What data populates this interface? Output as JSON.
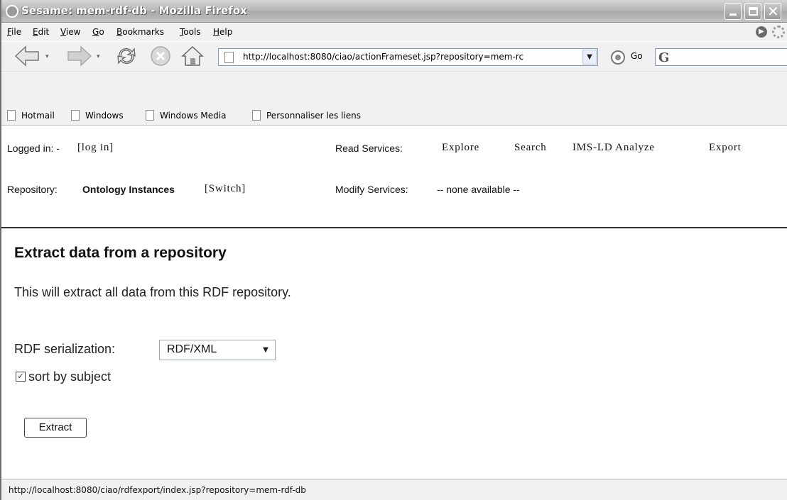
{
  "window": {
    "title": "Sesame: mem-rdf-db - Mozilla Firefox"
  },
  "menubar": {
    "items": [
      {
        "key": "F",
        "rest": "ile"
      },
      {
        "key": "E",
        "rest": "dit"
      },
      {
        "key": "V",
        "rest": "iew"
      },
      {
        "key": "G",
        "rest": "o"
      },
      {
        "key": "B",
        "rest": "ookmarks"
      },
      {
        "key": "T",
        "rest": "ools"
      },
      {
        "key": "H",
        "rest": "elp"
      }
    ]
  },
  "navbar": {
    "url": "http://localhost:8080/ciao/actionFrameset.jsp?repository=mem-rc",
    "go_label": "Go",
    "search_engine_glyph": "G",
    "icons": {
      "back": "back-arrow-icon",
      "forward": "forward-arrow-icon",
      "reload": "reload-icon",
      "stop": "stop-icon",
      "home": "home-icon"
    }
  },
  "bookmarks": [
    "Hotmail",
    "Windows",
    "Windows Media",
    "Personnaliser les liens"
  ],
  "header": {
    "logged_in": "Logged in: -",
    "log_in_link": "[log in]",
    "repository_label": "Repository:",
    "repository_name": "Ontology Instances",
    "switch_link": "[Switch]",
    "read_services_label": "Read Services:",
    "read_services": [
      "Explore",
      "Search",
      "IMS-LD Analyze",
      "Export"
    ],
    "modify_services_label": "Modify Services:",
    "modify_services_value": "-- none available --"
  },
  "main": {
    "title": "Extract data from a repository",
    "intro": "This will extract all data from this RDF repository.",
    "serialization_label": "RDF serialization:",
    "serialization_value": "RDF/XML",
    "sort_label": "sort by subject",
    "sort_checked": true,
    "extract_button": "Extract"
  },
  "statusbar": {
    "text": "http://localhost:8080/ciao/rdfexport/index.jsp?repository=mem-rdf-db"
  },
  "colors": {
    "chrome": "#f1f1f1",
    "titlebar": "#b8b8b8",
    "url_border": "#7f9db9"
  }
}
